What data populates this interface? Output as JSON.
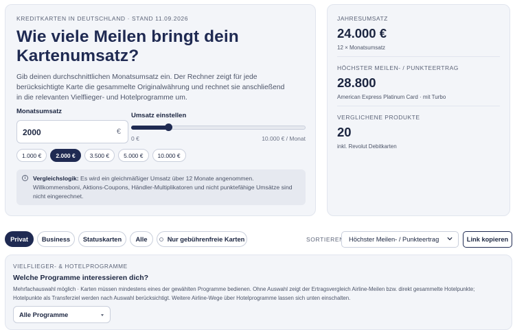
{
  "calculator": {
    "eyebrow": "KREDITKARTEN IN DEUTSCHLAND · STAND 11.09.2026",
    "title": "Wie viele Meilen bringt dein Kartenumsatz?",
    "intro": "Gib deinen durchschnittlichen Monatsumsatz ein. Der Rechner zeigt für jede berücksichtigte Karte die gesammelte Originalwährung und rechnet sie anschließend in die relevanten Vielflieger- und Hotelprogramme um.",
    "monthly_label": "Monatsumsatz",
    "monthly_value": "2000",
    "currency": "€",
    "slider_label": "Umsatz einstellen",
    "slider_min_label": "0 €",
    "slider_max_label": "10.000 € / Monat",
    "slider_min": 0,
    "slider_max": 10000,
    "slider_value": 2000,
    "presets": [
      {
        "label": "1.000 €",
        "active": false
      },
      {
        "label": "2.000 €",
        "active": true
      },
      {
        "label": "3.500 €",
        "active": false
      },
      {
        "label": "5.000 €",
        "active": false
      },
      {
        "label": "10.000 €",
        "active": false
      }
    ],
    "note_bold": "Vergleichslogik:",
    "note_text": " Es wird ein gleichmäßiger Umsatz über 12 Monate angenommen. Willkommensboni, Aktions-Coupons, Händler-Multiplikatoren und nicht punktefähige Umsätze sind nicht eingerechnet.",
    "info_icon": "info-icon"
  },
  "stats": {
    "annual": {
      "label": "JAHRESUMSATZ",
      "value": "24.000 €",
      "sub": "12 × Monatsumsatz"
    },
    "top": {
      "label": "HÖCHSTER MEILEN- / PUNKTEERTRAG",
      "value": "28.800",
      "sub": "American Express Platinum Card · mit Turbo"
    },
    "compared": {
      "label": "VERGLICHENE PRODUKTE",
      "value": "20",
      "sub": "inkl. Revolut Debitkarten"
    }
  },
  "toolbar": {
    "filters": [
      {
        "label": "Privat",
        "active": true
      },
      {
        "label": "Business",
        "active": false
      },
      {
        "label": "Statuskarten",
        "active": false
      },
      {
        "label": "Alle",
        "active": false
      }
    ],
    "fee_free_label": "Nur gebührenfreie Karten",
    "sort_label": "SORTIEREN",
    "sort_value": "Höchster Meilen- / Punkteertrag",
    "copy_label": "Link kopieren"
  },
  "programs": {
    "eyebrow": "VIELFLIEGER- & HOTELPROGRAMME",
    "title": "Welche Programme interessieren dich?",
    "description": "Mehrfachauswahl möglich · Karten müssen mindestens eines der gewählten Programme bedienen. Ohne Auswahl zeigt der Ertragsvergleich Airline-Meilen bzw. direkt gesammelte Hotelpunkte; Hotelpunkte als Transferziel werden nach Auswahl berücksichtigt. Weitere Airline-Wege über Hotelprogramme lassen sich unten einschalten.",
    "dropdown_value": "Alle Programme"
  },
  "colors": {
    "accent": "#1f2a52",
    "card_bg": "#f3f5f9",
    "border": "#c9cfdc"
  }
}
